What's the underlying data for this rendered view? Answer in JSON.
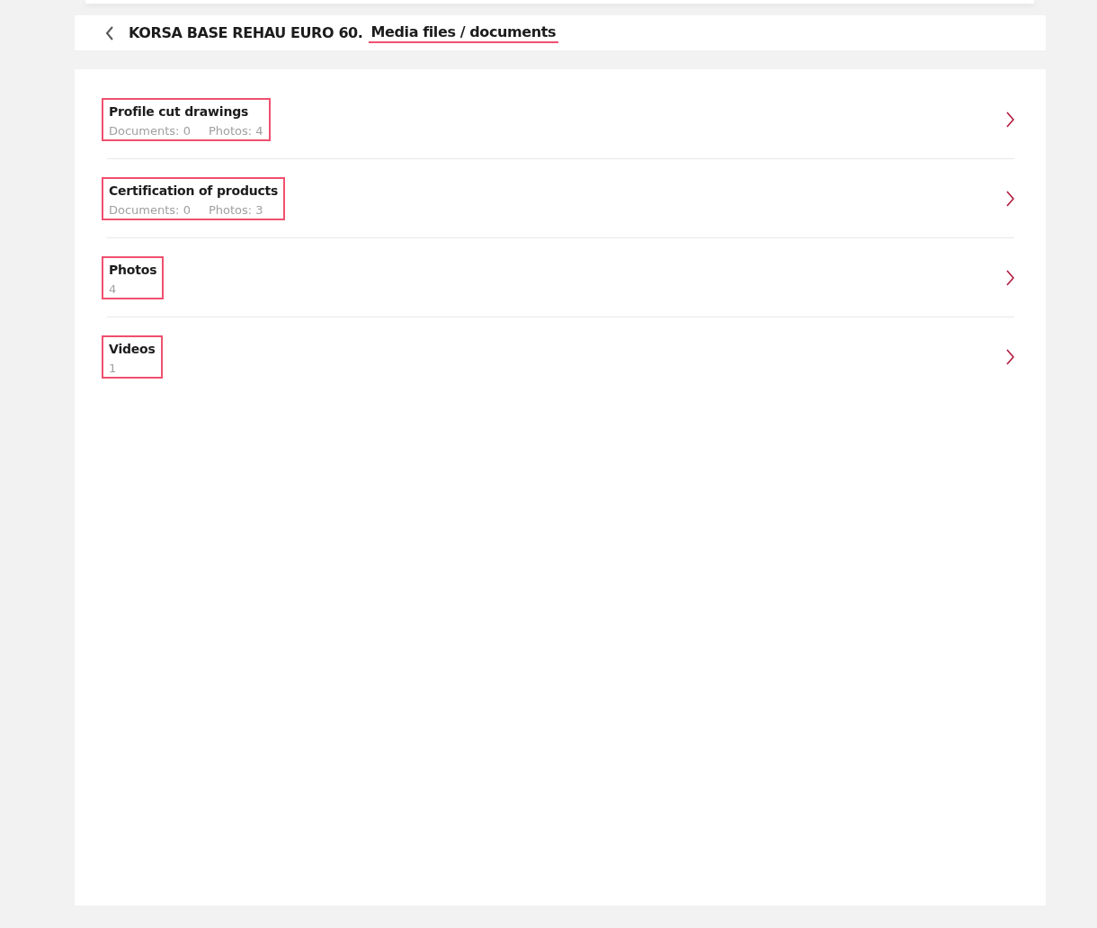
{
  "header": {
    "title": "KORSA BASE REHAU EURO 60.",
    "subtitle": "Media files / documents",
    "subtitle_highlighted": true
  },
  "items": [
    {
      "title": "Profile cut drawings",
      "meta": [
        "Documents: 0",
        "Photos: 4"
      ],
      "highlighted": true
    },
    {
      "title": "Certification of products",
      "meta": [
        "Documents: 0",
        "Photos: 3"
      ],
      "highlighted": true
    },
    {
      "title": "Photos",
      "meta": [
        "4"
      ],
      "highlighted": true
    },
    {
      "title": "Videos",
      "meta": [
        "1"
      ],
      "highlighted": true
    }
  ]
}
